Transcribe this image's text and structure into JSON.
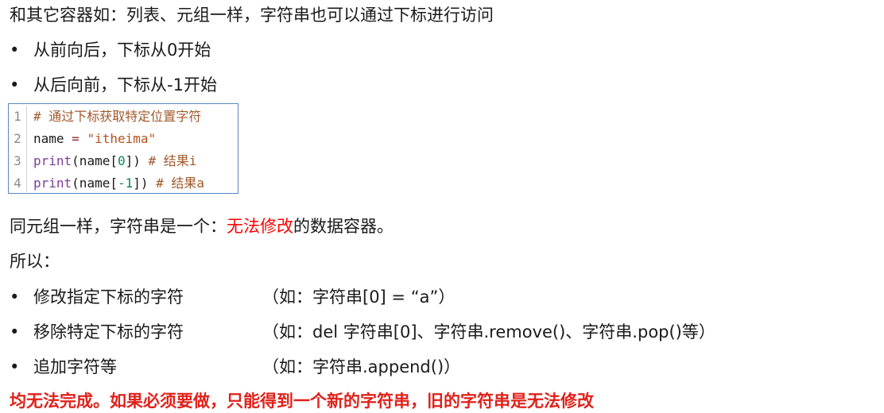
{
  "intro": "和其它容器如：列表、元组一样，字符串也可以通过下标进行访问",
  "bullets_top": [
    "从前向后，下标从0开始",
    "从后向前，下标从-1开始"
  ],
  "code": {
    "line_numbers": [
      "1",
      "2",
      "3",
      "4"
    ],
    "line1_comment": "# 通过下标获取特定位置字符",
    "line2_var": "name",
    "line2_eq": " = ",
    "line2_str": "\"itheima\"",
    "line3_fn": "print",
    "line3_open": "(name[",
    "line3_idx": "0",
    "line3_close": "])",
    "line3_comment": "  # 结果i",
    "line4_fn": "print",
    "line4_open": "(name[",
    "line4_idx": "-1",
    "line4_close": "])",
    "line4_comment": " # 结果a"
  },
  "immutable_prefix": "同元组一样，字符串是一个：",
  "immutable_highlight": "无法修改",
  "immutable_suffix": "的数据容器。",
  "so_label": "所以：",
  "operations": [
    {
      "label": "修改指定下标的字符",
      "example": "（如：字符串[0] = “a”）"
    },
    {
      "label": "移除特定下标的字符",
      "example": "（如：del 字符串[0]、字符串.remove()、字符串.pop()等）"
    },
    {
      "label": "追加字符等",
      "example": "（如：字符串.append()）"
    }
  ],
  "conclusion": "均无法完成。如果必须要做，只能得到一个新的字符串，旧的字符串是无法修改",
  "bullet_char": "•"
}
